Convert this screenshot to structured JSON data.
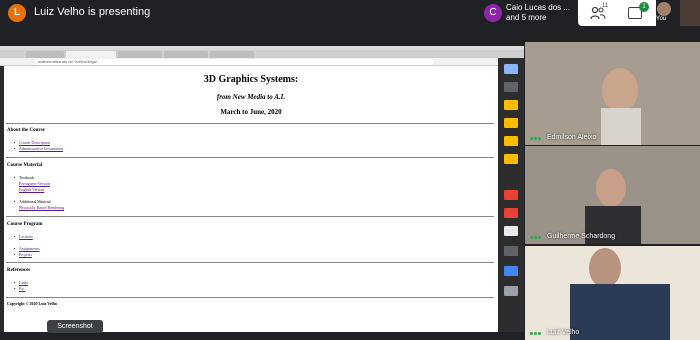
{
  "meeting": {
    "presenter_initial": "L",
    "presenting_text": "Luiz Velho is presenting",
    "participants_avatar_initial": "C",
    "participants_line1": "Caio Lucas dos ...",
    "participants_line2": "and 5 more",
    "people_count": "11",
    "chat_badge": "1",
    "you_label": "You",
    "tooltip": "Screenshot"
  },
  "browser": {
    "url": "mathematica.ufs.br/~lvelho/3dgs/"
  },
  "page": {
    "title": "3D Graphics Systems:",
    "subtitle": "from New Media to A.I.",
    "date": "March to June, 2020",
    "sections": [
      {
        "heading": "About the Course",
        "links": [
          "Course Description",
          "Administrative Information"
        ]
      },
      {
        "heading": "Course Material",
        "textbook_label": "Textbook",
        "textbook_links": [
          "Portuguese Version",
          "English Version"
        ],
        "additional_label": "Additional Material",
        "additional_links": [
          "Physically Based Rendering"
        ]
      },
      {
        "heading": "Course Program",
        "links": [
          "Lectures",
          "Assignments",
          "Projects"
        ]
      },
      {
        "heading": "References",
        "links": [
          "Links",
          "Etc."
        ]
      }
    ],
    "copyright": "Copyright © 2020 Luiz Velho"
  },
  "tiles": [
    {
      "name": "Edmilson Aleixo"
    },
    {
      "name": "Guilherme Schardong"
    },
    {
      "name": "Luiz Velho"
    }
  ],
  "colors": {
    "accent_green": "#1e8e3e",
    "presenter_orange": "#e8710a",
    "link_purple": "#551a8b"
  }
}
